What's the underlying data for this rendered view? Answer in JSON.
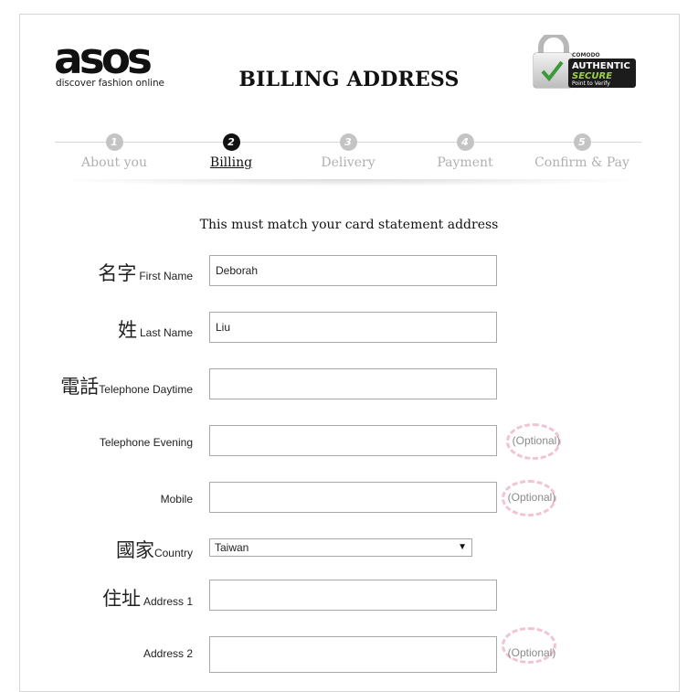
{
  "header": {
    "logo_word": "asos",
    "logo_tagline": "discover fashion online",
    "title": "BILLING ADDRESS",
    "badge": {
      "brand": "COMODO",
      "line1": "AUTHENTIC",
      "line2": "SECURE",
      "line3": "Point to Verify"
    }
  },
  "steps": [
    {
      "num": "1",
      "label": "About you",
      "active": false
    },
    {
      "num": "2",
      "label": "Billing",
      "active": true
    },
    {
      "num": "3",
      "label": "Delivery",
      "active": false
    },
    {
      "num": "4",
      "label": "Payment",
      "active": false
    },
    {
      "num": "5",
      "label": "Confirm & Pay",
      "active": false
    }
  ],
  "subtitle": "This must match your card statement address",
  "form": {
    "first_name": {
      "cjk": "名字",
      "label": "First Name",
      "value": "Deborah"
    },
    "last_name": {
      "cjk": "姓",
      "label": "Last Name",
      "value": "Liu"
    },
    "phone_day": {
      "cjk": "電話",
      "label": "Telephone Daytime",
      "value": ""
    },
    "phone_evening": {
      "label": "Telephone Evening",
      "value": "",
      "optional": "(Optional)"
    },
    "mobile": {
      "label": "Mobile",
      "value": "",
      "optional": "(Optional)"
    },
    "country": {
      "cjk": "國家",
      "label": "Country",
      "value": "Taiwan"
    },
    "address1": {
      "cjk": "住址",
      "label": "Address 1",
      "value": ""
    },
    "address2": {
      "label": "Address 2",
      "value": "",
      "optional": "(Optional)"
    }
  },
  "colors": {
    "active_step": "#111111",
    "inactive_step": "#c4c4c4",
    "optional_ring": "#f2c4d2"
  }
}
